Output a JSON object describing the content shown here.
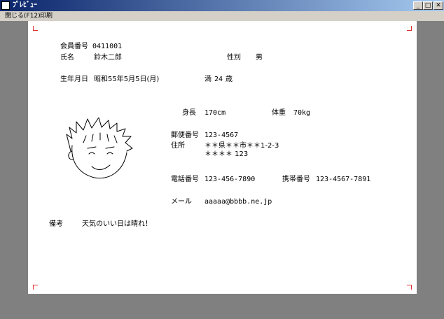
{
  "window": {
    "title": "ﾌﾟﾚﾋﾞｭｰ",
    "min_label": "_",
    "max_label": "□",
    "close_label": "✕"
  },
  "menu": {
    "close_label": "閉じる(F12)",
    "print_label": "印刷"
  },
  "record": {
    "member_no_label": "会員番号",
    "member_no": "0411001",
    "name_label": "氏名",
    "name": "鈴木二郎",
    "gender_label": "性別",
    "gender": "男",
    "birth_label": "生年月日",
    "birth": "昭和55年5月5日(月)",
    "age_prefix": "満",
    "age": "24",
    "age_unit": "歳",
    "height_label": "身長",
    "height": "170cm",
    "weight_label": "体重",
    "weight": "70kg",
    "postal_label": "郵便番号",
    "postal": "123-4567",
    "address_label": "住所",
    "address_line1": "＊＊県＊＊市＊＊1-2-3",
    "address_line2": "＊＊＊＊ 123",
    "phone_label": "電話番号",
    "phone": "123-456-7890",
    "mobile_label": "携帯番号",
    "mobile": "123-4567-7891",
    "mail_label": "メール",
    "mail": "aaaaa@bbbb.ne.jp",
    "note_label": "備考",
    "note": "天気のいい日は晴れ！"
  },
  "colors": {
    "crop_mark": "#e03030",
    "titlebar_start": "#0a246a",
    "titlebar_end": "#a6caf0"
  }
}
